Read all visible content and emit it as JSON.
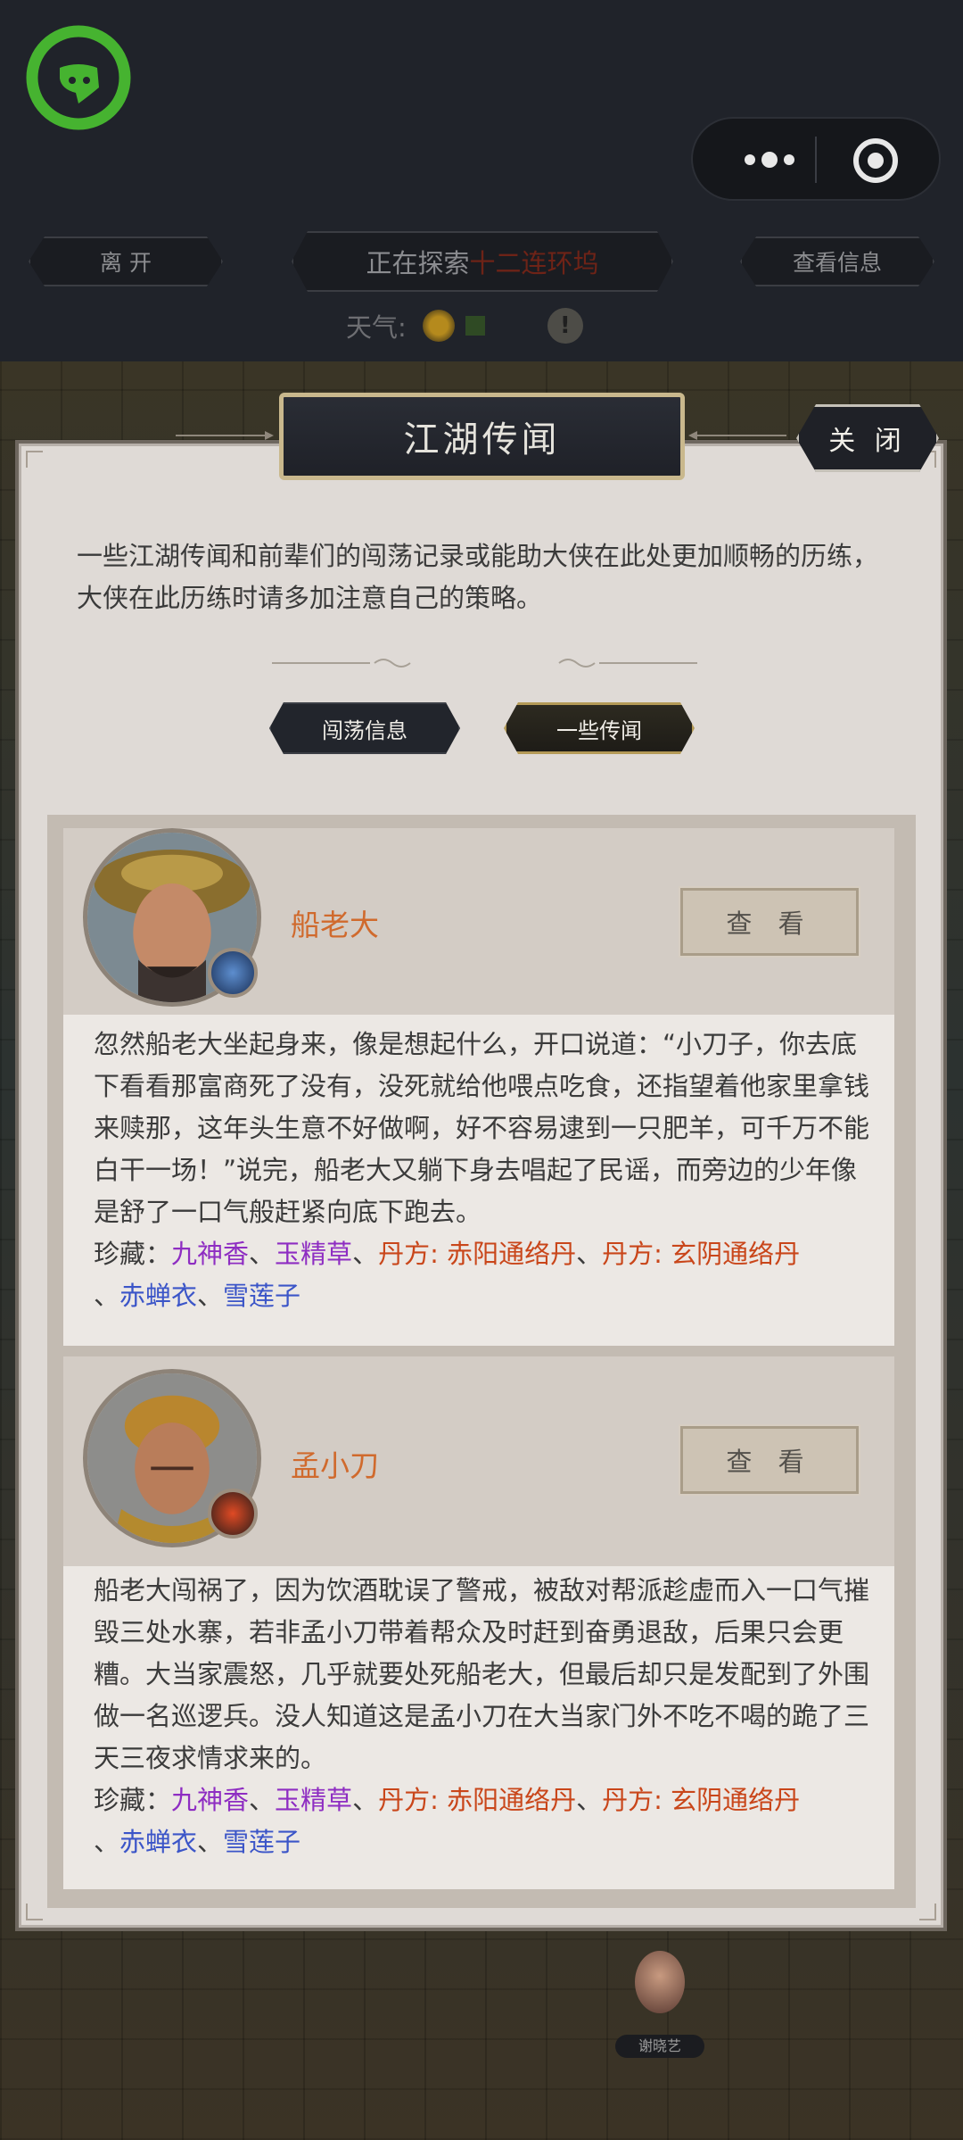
{
  "header": {
    "leave_label": "离 开",
    "explore_prefix": "正在探索",
    "explore_location": "十二连环坞",
    "info_label": "查看信息",
    "weather_label": "天气:",
    "weather_info_icon": "!"
  },
  "dialog": {
    "title": "江湖传闻",
    "close_label": "关 闭",
    "intro": "一些江湖传闻和前辈们的闯荡记录或能助大侠在此处更加顺畅的历练，大侠在此历练时请多加注意自己的策略。",
    "tabs": [
      {
        "label": "闯荡信息",
        "active": false
      },
      {
        "label": "一些传闻",
        "active": true
      }
    ],
    "view_label": "查 看",
    "treasure_prefix": "珍藏：",
    "cards": [
      {
        "name": "船老大",
        "story": "忽然船老大坐起身来，像是想起什么，开口说道：“小刀子，你去底下看看那富商死了没有，没死就给他喂点吃食，还指望着他家里拿钱来赎那，这年头生意不好做啊，好不容易逮到一只肥羊，可千万不能白干一场！”说完，船老大又躺下身去唱起了民谣，而旁边的少年像是舒了一口气般赶紧向底下跑去。",
        "treasures": [
          "九神香",
          "玉精草",
          "丹方: 赤阳通络丹",
          "丹方: 玄阴通络丹",
          "赤蝉衣",
          "雪莲子"
        ]
      },
      {
        "name": "孟小刀",
        "story": "船老大闯祸了，因为饮酒耽误了警戒，被敌对帮派趁虚而入一口气摧毁三处水寨，若非孟小刀带着帮众及时赶到奋勇退敌，后果只会更糟。大当家震怒，几乎就要处死船老大，但最后却只是发配到了外围做一名巡逻兵。没人知道这是孟小刀在大当家门外不吃不喝的跪了三天三夜求情求来的。",
        "treasures": [
          "九神香",
          "玉精草",
          "丹方: 赤阳通络丹",
          "丹方: 玄阴通络丹",
          "赤蝉衣",
          "雪莲子"
        ]
      }
    ]
  },
  "map": {
    "npc_label": "谢晓艺"
  },
  "colors": {
    "treasure_purple": "#8e2dc2",
    "treasure_orange": "#c9461a",
    "treasure_blue": "#3b55c8",
    "name_orange": "#d06a2d"
  }
}
